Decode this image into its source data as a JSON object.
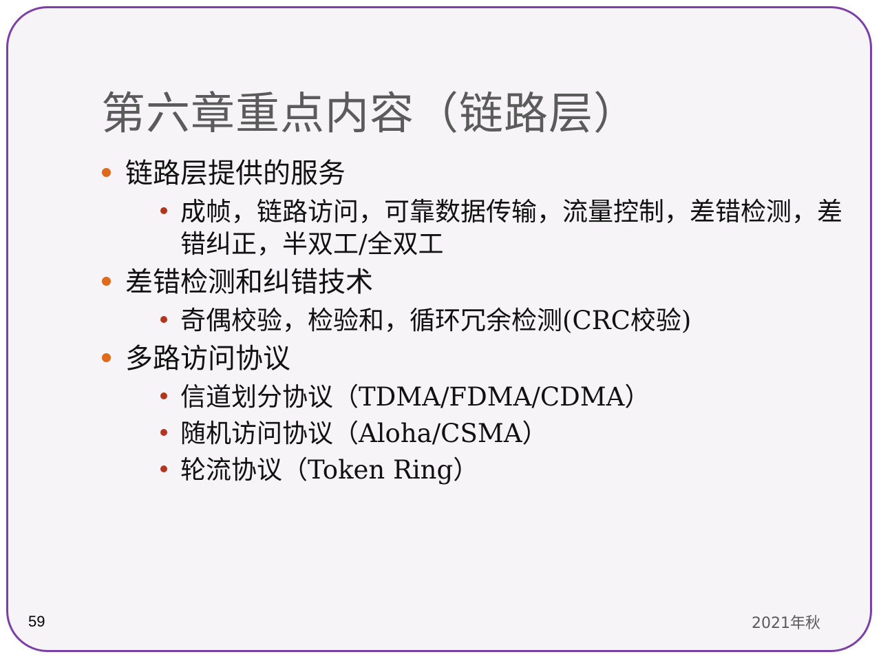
{
  "slide": {
    "title": "第六章重点内容（链路层）",
    "page_number": "59",
    "footer_date": "2021年秋",
    "colors": {
      "frame_border": "#7b3fa8",
      "background": "#f6f4f6",
      "title_text": "#5b5b5b",
      "bullet_level1": "#e06a1b",
      "bullet_level2": "#b2361e"
    },
    "bullets": [
      {
        "text": "链路层提供的服务",
        "children": [
          "成帧，链路访问，可靠数据传输，流量控制，差错检测，差错纠正，半双工/全双工"
        ]
      },
      {
        "text": "差错检测和纠错技术",
        "children": [
          "奇偶校验，检验和，循环冗余检测(CRC校验)"
        ]
      },
      {
        "text": "多路访问协议",
        "children": [
          "信道划分协议（TDMA/FDMA/CDMA）",
          "随机访问协议（Aloha/CSMA）",
          "轮流协议（Token Ring）"
        ]
      }
    ]
  }
}
